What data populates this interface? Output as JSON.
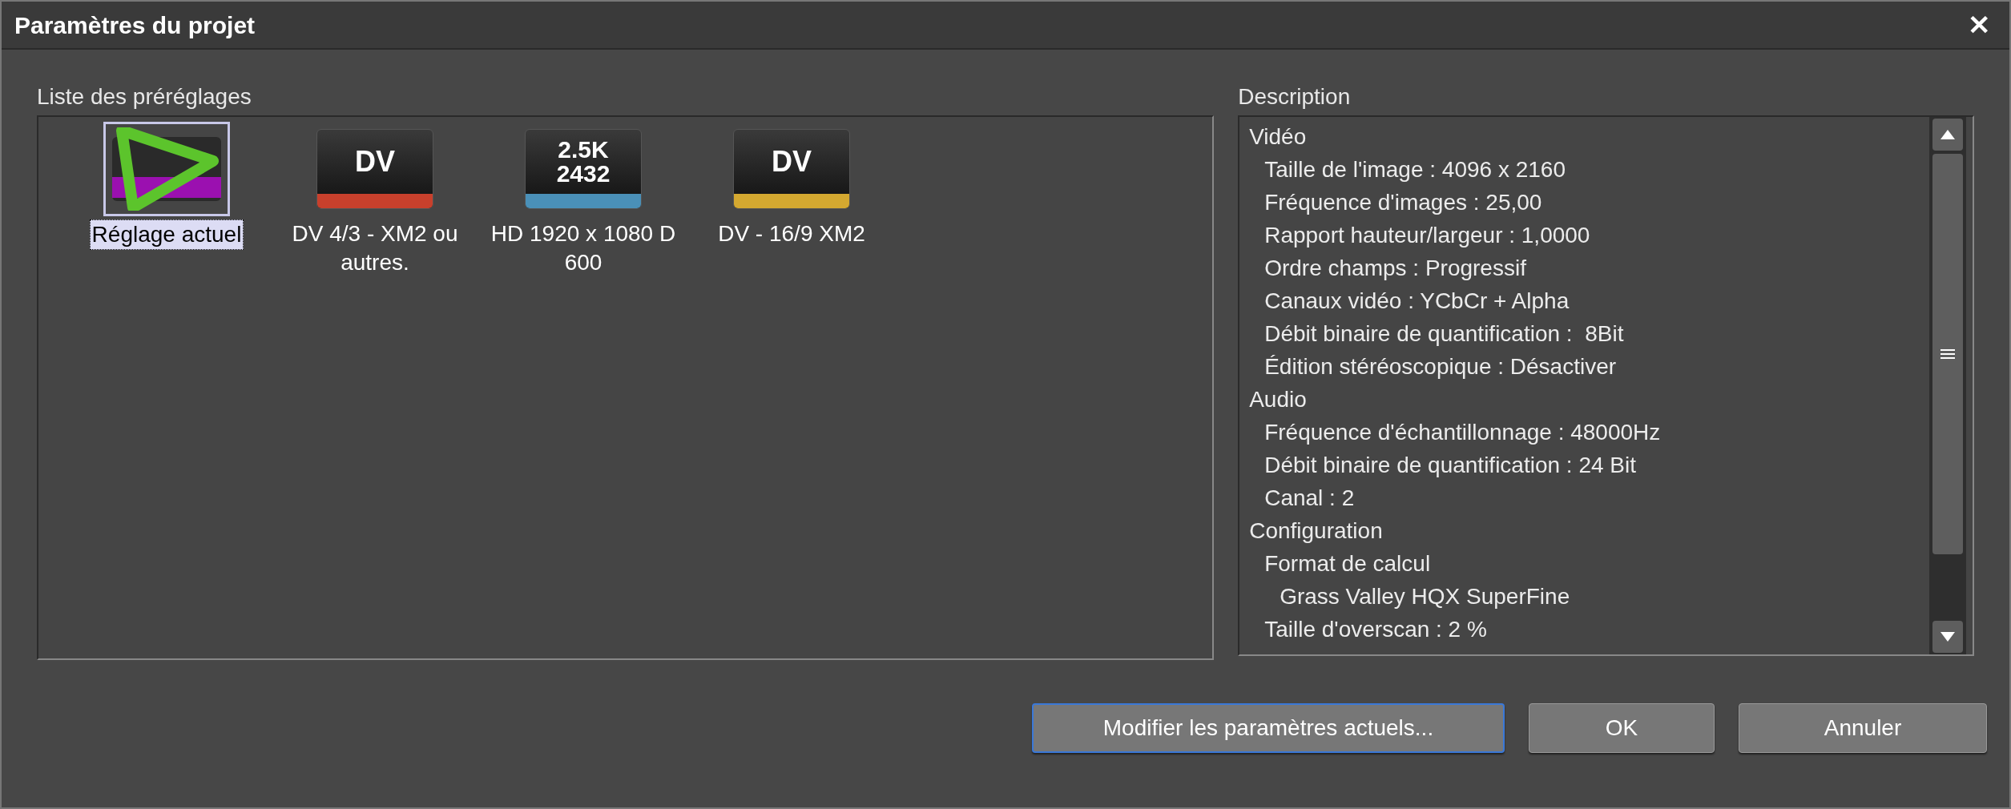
{
  "window": {
    "title": "Paramètres du projet",
    "close": "✕"
  },
  "presets": {
    "label": "Liste des préréglages",
    "items": [
      {
        "kind": "play",
        "label": "Réglage actuel",
        "selected": true,
        "color": "#9b10b0"
      },
      {
        "kind": "badge",
        "badge": [
          "DV"
        ],
        "label": "DV 4/3 - XM2 ou autres.",
        "selected": false,
        "color": "#c8402c"
      },
      {
        "kind": "badge",
        "badge": [
          "2.5K",
          "2432"
        ],
        "label": "HD 1920 x 1080 D 600",
        "selected": false,
        "color": "#4a90b8"
      },
      {
        "kind": "badge",
        "badge": [
          "DV"
        ],
        "label": "DV - 16/9 XM2",
        "selected": false,
        "color": "#d4a830"
      }
    ]
  },
  "description": {
    "label": "Description",
    "tree": [
      {
        "text": "Vidéo",
        "children": [
          {
            "text": "Taille de l'image : 4096 x 2160"
          },
          {
            "text": "Fréquence d'images : 25,00"
          },
          {
            "text": "Rapport hauteur/largeur : 1,0000"
          },
          {
            "text": "Ordre champs : Progressif"
          },
          {
            "text": "Canaux vidéo : YCbCr + Alpha"
          },
          {
            "text": "Débit binaire de quantification :  8Bit"
          },
          {
            "text": "Édition stéréoscopique : Désactiver"
          }
        ]
      },
      {
        "text": "Audio",
        "children": [
          {
            "text": "Fréquence d'échantillonnage : 48000Hz"
          },
          {
            "text": "Débit binaire de quantification : 24 Bit"
          },
          {
            "text": "Canal : 2"
          }
        ]
      },
      {
        "text": "Configuration",
        "children": [
          {
            "text": "Format de calcul",
            "children": [
              {
                "text": "Grass Valley HQX SuperFine"
              }
            ]
          },
          {
            "text": "Taille d'overscan : 2 %"
          }
        ]
      }
    ]
  },
  "buttons": [
    {
      "label": "Modifier les paramètres actuels...",
      "focused": true
    },
    {
      "label": "OK",
      "focused": false
    },
    {
      "label": "Annuler",
      "focused": false
    }
  ]
}
